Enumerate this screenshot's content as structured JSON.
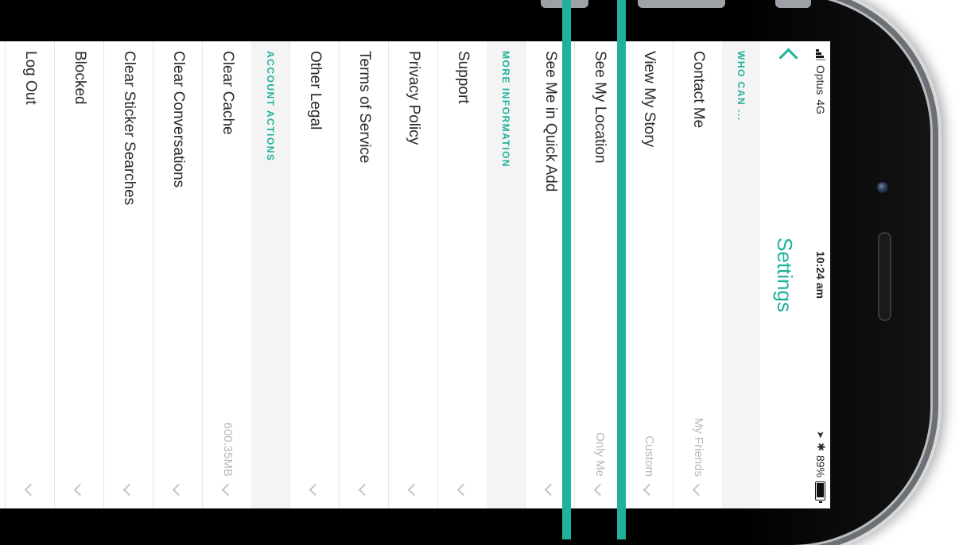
{
  "status": {
    "carrier": "Optus",
    "network": "4G",
    "time": "10:24 am",
    "battery": "89%",
    "battery_level": 0.89
  },
  "nav": {
    "title": "Settings"
  },
  "sections": [
    {
      "header": "WHO CAN ...",
      "rows": [
        {
          "label": "Contact Me",
          "value": "My Friends"
        },
        {
          "label": "View My Story",
          "value": "Custom"
        },
        {
          "label": "See My Location",
          "value": "Only Me"
        },
        {
          "label": "See Me in Quick Add",
          "value": ""
        }
      ]
    },
    {
      "header": "MORE INFORMATION",
      "rows": [
        {
          "label": "Support",
          "value": ""
        },
        {
          "label": "Privacy Policy",
          "value": ""
        },
        {
          "label": "Terms of Service",
          "value": ""
        },
        {
          "label": "Other Legal",
          "value": ""
        }
      ]
    },
    {
      "header": "ACCOUNT ACTIONS",
      "rows": [
        {
          "label": "Clear Cache",
          "value": "600.35MB"
        },
        {
          "label": "Clear Conversations",
          "value": ""
        },
        {
          "label": "Clear Sticker Searches",
          "value": ""
        },
        {
          "label": "Blocked",
          "value": ""
        },
        {
          "label": "Log Out",
          "value": ""
        }
      ]
    }
  ],
  "colors": {
    "accent": "#1fb19b",
    "section_bg": "#f4f4f4",
    "value_text": "#b9b9b9"
  },
  "icons": [
    "signal-icon",
    "back-chevron-icon",
    "location-arrow-icon",
    "bluetooth-icon",
    "battery-icon",
    "chevron-right-icon"
  ]
}
